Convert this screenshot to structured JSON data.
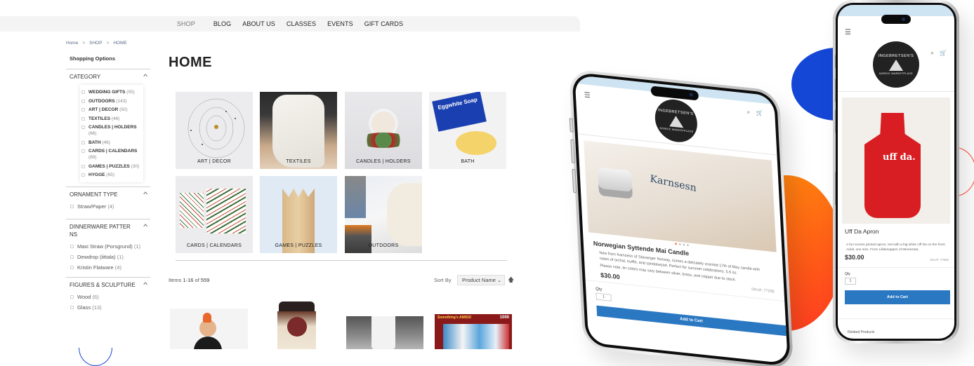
{
  "colors": {
    "nav_bg": "#f4f4f4",
    "accent_blue": "#1447d6",
    "accent_orange": "#ff5d17",
    "accent_red": "#ff4b30",
    "cart_button": "#2b78c2"
  },
  "nav": {
    "items": [
      {
        "label": "SHOP",
        "active": true
      },
      {
        "label": "BLOG"
      },
      {
        "label": "ABOUT US"
      },
      {
        "label": "CLASSES"
      },
      {
        "label": "EVENTS"
      },
      {
        "label": "GIFT CARDS"
      }
    ]
  },
  "breadcrumb": {
    "items": [
      "Home",
      "SHOP",
      "HOME"
    ],
    "separator": ">"
  },
  "sidebar": {
    "heading": "Shopping Options",
    "category": {
      "title": "CATEGORY",
      "options": [
        {
          "label": "WEDDING GIFTS",
          "count": "(55)"
        },
        {
          "label": "OUTDOORS",
          "count": "(143)"
        },
        {
          "label": "ART | DECOR",
          "count": "(92)"
        },
        {
          "label": "TEXTILES",
          "count": "(46)"
        },
        {
          "label": "CANDLES | HOLDERS",
          "count": "(66)"
        },
        {
          "label": "BATH",
          "count": "(46)"
        },
        {
          "label": "CARDS | CALENDARS",
          "count": "(89)"
        },
        {
          "label": "GAMES | PUZZLES",
          "count": "(30)"
        },
        {
          "label": "HYGGE",
          "count": "(65)"
        }
      ]
    },
    "ornament_type": {
      "title": "ORNAMENT TYPE",
      "options": [
        {
          "label": "Straw/Paper",
          "count": "(4)"
        }
      ]
    },
    "dinnerware": {
      "title": "DINNERWARE PATTER NS",
      "options": [
        {
          "label": "Maxi Straw (Porsgrund)",
          "count": "(1)"
        },
        {
          "label": "Dewdrop (iittala)",
          "count": "(1)"
        },
        {
          "label": "Kristin Flatware",
          "count": "(4)"
        }
      ]
    },
    "figures": {
      "title": "FIGURES & SCULPTURE",
      "options": [
        {
          "label": "Wood",
          "count": "(6)"
        },
        {
          "label": "Glass",
          "count": "(13)"
        }
      ]
    }
  },
  "main": {
    "title": "HOME",
    "tiles": [
      {
        "label": "ART | DECOR"
      },
      {
        "label": "TEXTILES"
      },
      {
        "label": "CANDLES | HOLDERS"
      },
      {
        "label": "BATH"
      },
      {
        "label": "CARDS | CALENDARS"
      },
      {
        "label": "GAMES | PUZZLES"
      },
      {
        "label": "OUTDOORS"
      }
    ],
    "toolbar": {
      "items_prefix": "Items",
      "items_range": "1-16",
      "items_of": "of",
      "items_total": "559",
      "sort_label": "Sort By",
      "sort_value": "Product Name",
      "sort_dir_icon": "arrow-up-icon"
    }
  },
  "phone_left": {
    "menu_icon": "☰",
    "header_icons": "⌕ 🛒",
    "logo": {
      "top": "INGEBRETSEN'S",
      "bottom": "NORDIC MARKETPLACE"
    },
    "product": {
      "title": "Norwegian Syttende Mai Candle",
      "desc1": "New from Kamsesn of Stavanger Norway, comes a delicately scented 17th of May candle with notes of orchid, truffle, and sandalwood. Perfect for summer celebrations. 5.6 oz.",
      "desc2": "Please note, tin colors may vary between silver, brass, and copper due to stock.",
      "price": "$30.00",
      "sku": "SKU#: 77206",
      "qty_label": "Qty",
      "qty": "1",
      "add_to_cart": "Add to Cart"
    }
  },
  "phone_right": {
    "menu_icon": "☰",
    "header_icons": "⌕ 🛒",
    "logo": {
      "top": "INGEBRETSEN'S",
      "bottom": "NORDIC MARKETPLACE"
    },
    "product": {
      "title": "Uff Da Apron",
      "apron_text": "uff da.",
      "desc": "A fun screen printed apron, red with a big white Uff Da on the front. Adult, one size. From Lillaknappen of Minnesota.",
      "price": "$30.00",
      "sku": "SKU#: 77500",
      "qty_label": "Qty",
      "qty": "1",
      "add_to_cart": "Add to Cart",
      "related": "Related Products"
    }
  }
}
